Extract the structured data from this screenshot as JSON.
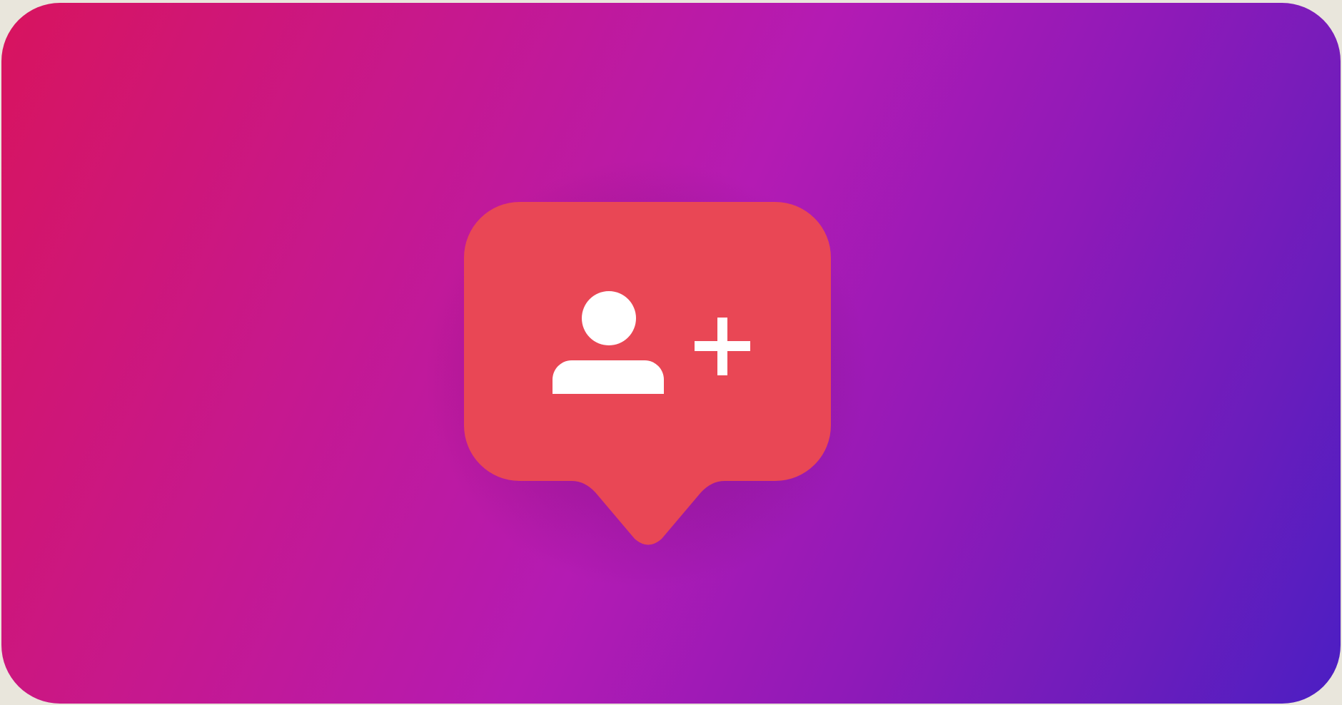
{
  "banner": {
    "background_colors": [
      "#d8145e",
      "#b41bb3",
      "#4b1ec3"
    ],
    "badge_color": "#e94755",
    "icon_color": "#ffffff",
    "icons": [
      "notification-bubble-icon",
      "user-icon",
      "plus-icon"
    ]
  }
}
